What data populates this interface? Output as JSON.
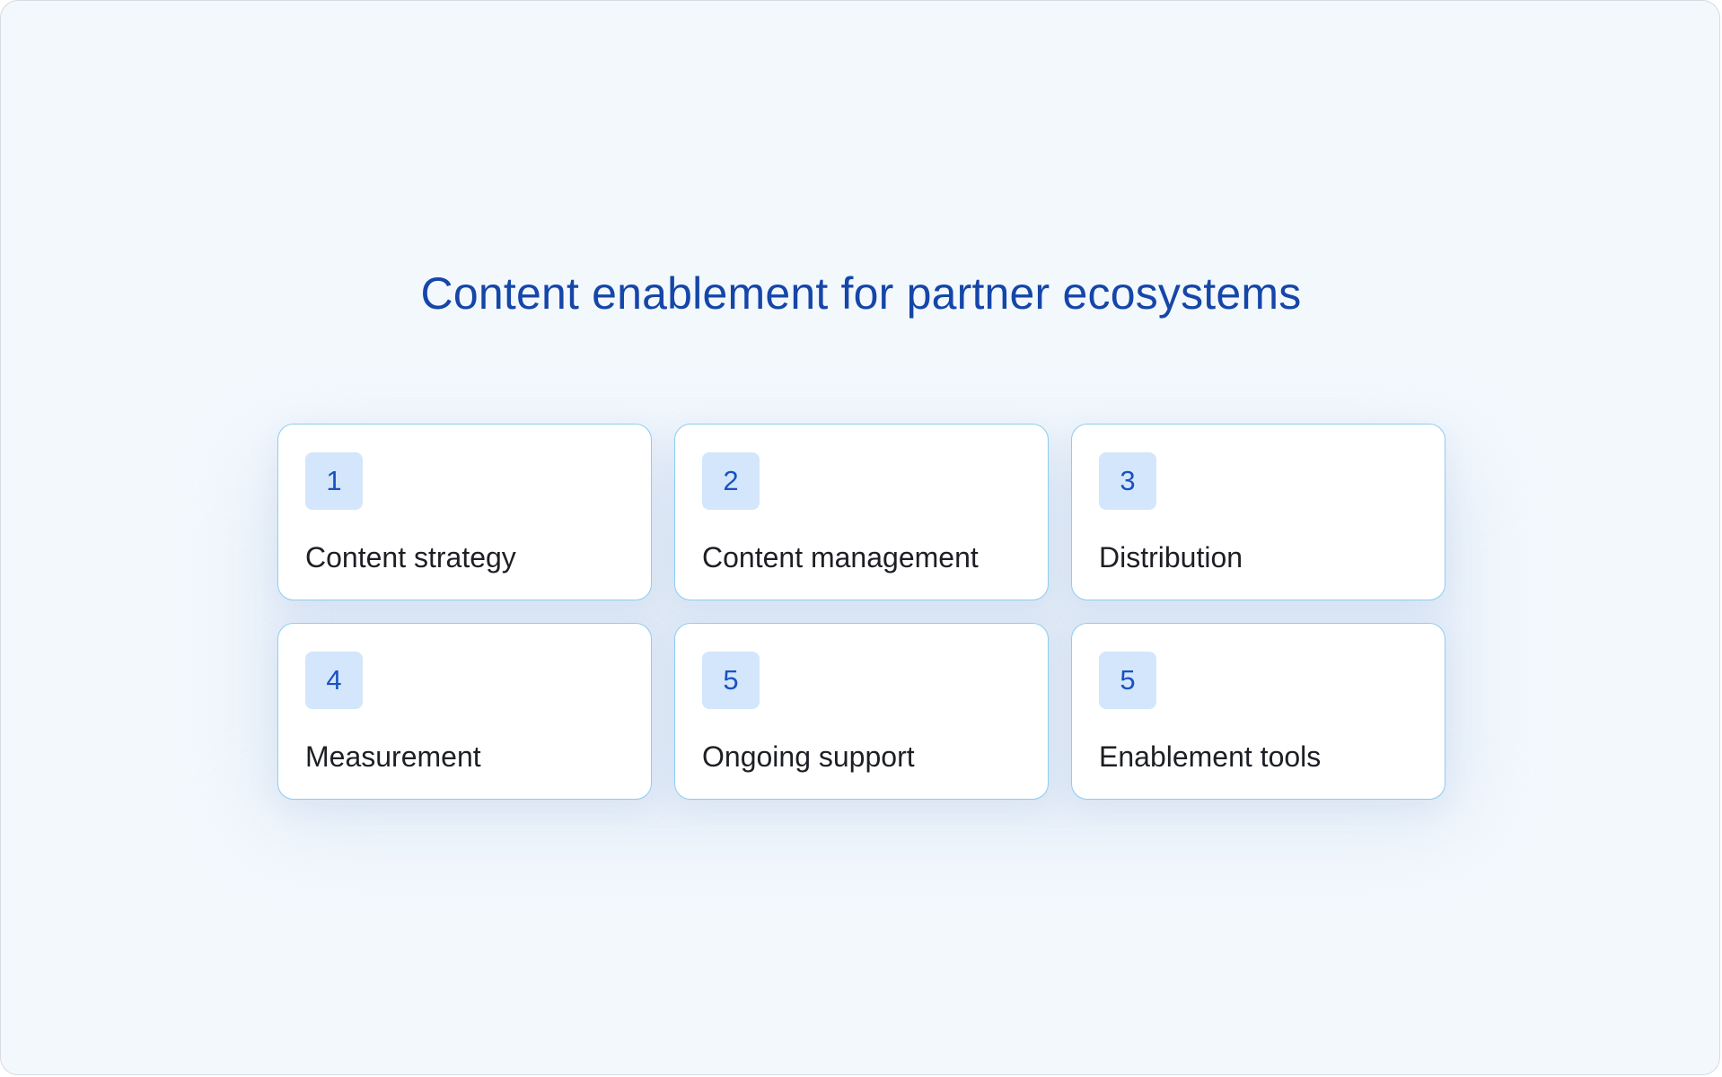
{
  "title": "Content enablement for partner ecosystems",
  "cards": [
    {
      "number": "1",
      "label": "Content strategy"
    },
    {
      "number": "2",
      "label": "Content management"
    },
    {
      "number": "3",
      "label": "Distribution"
    },
    {
      "number": "4",
      "label": "Measurement"
    },
    {
      "number": "5",
      "label": "Ongoing support"
    },
    {
      "number": "5",
      "label": "Enablement tools"
    }
  ],
  "colors": {
    "background": "#f3f8fd",
    "title": "#1546a8",
    "card_border": "#8fccf1",
    "badge_bg": "#d3e6fb",
    "badge_text": "#1a52c0",
    "label_text": "#1d1f24"
  }
}
